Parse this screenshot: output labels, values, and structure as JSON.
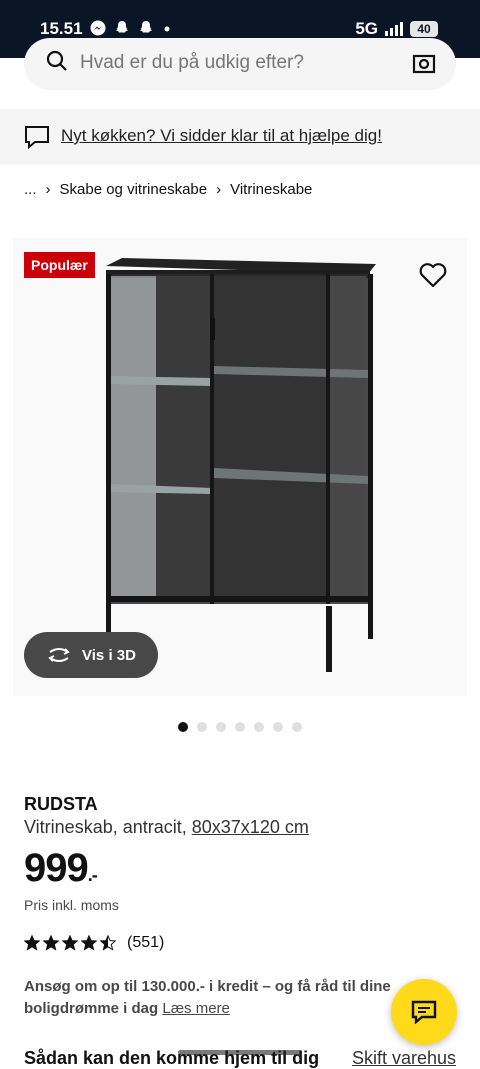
{
  "status_bar": {
    "time": "15.51",
    "network": "5G",
    "battery": "40"
  },
  "search": {
    "placeholder": "Hvad er du på udkig efter?"
  },
  "banner": {
    "text": "Nyt køkken? Vi sidder klar til at hjælpe dig!"
  },
  "breadcrumb": {
    "items": [
      "...",
      "Skabe og vitrineskabe",
      "Vitrineskabe"
    ]
  },
  "product": {
    "badge": "Populær",
    "view_3d_label": "Vis i 3D",
    "carousel": {
      "total": 7,
      "active": 1
    },
    "name": "RUDSTA",
    "description": "Vitrineskab, antracit,",
    "size": "80x37x120 cm",
    "price": "999",
    "price_suffix": ".-",
    "vat_note": "Pris inkl. moms",
    "rating": {
      "stars": 4.5,
      "count": "(551)"
    }
  },
  "credit": {
    "text": "Ansøg om op til 130.000.- i kredit – og få råd til dine boligdrømme i dag",
    "link": "Læs mere"
  },
  "delivery": {
    "heading": "Sådan kan den komme hjem til dig",
    "change_store": "Skift varehus"
  },
  "colors": {
    "status_bg": "#0a1526",
    "badge_red": "#cc0008",
    "chat_yellow": "#ffda1a",
    "gray_button": "#484848"
  },
  "icons": [
    "messenger-icon",
    "snapchat-icon",
    "search-icon",
    "camera-icon",
    "chat-icon",
    "heart-icon",
    "rotate-3d-icon",
    "star-icon"
  ]
}
